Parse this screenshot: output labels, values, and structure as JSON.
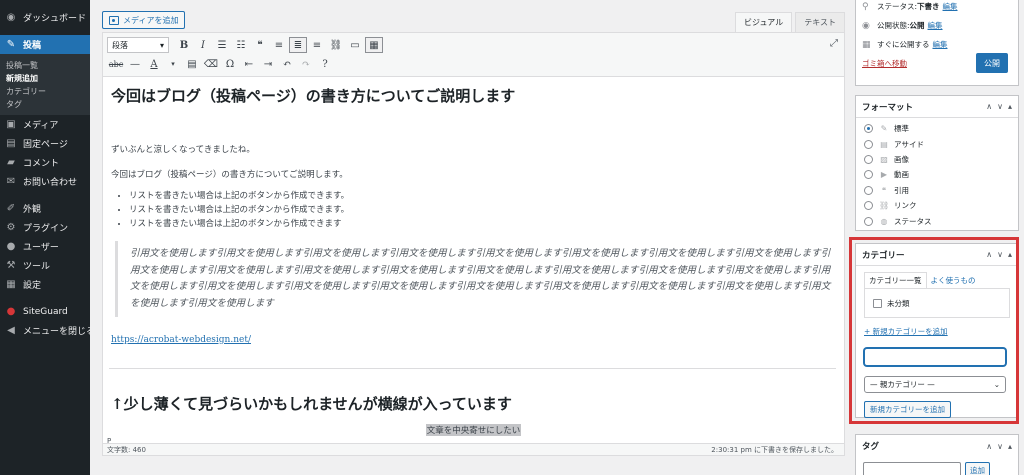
{
  "menu": {
    "dashboard": "ダッシュボード",
    "posts": "投稿",
    "posts_sub": [
      "投稿一覧",
      "新規追加",
      "カテゴリー",
      "タグ"
    ],
    "media": "メディア",
    "pages": "固定ページ",
    "comments": "コメント",
    "contact": "お問い合わせ",
    "appearance": "外観",
    "plugins": "プラグイン",
    "users": "ユーザー",
    "tools": "ツール",
    "settings": "設定",
    "siteguard": "SiteGuard",
    "collapse": "メニューを閉じる"
  },
  "editor": {
    "media_button": "メディアを追加",
    "tab_visual": "ビジュアル",
    "tab_text": "テキスト",
    "format_select": "段落",
    "title": "今回はブログ（投稿ページ）の書き方についてご説明します",
    "para1": "ずいぶんと涼しくなってきましたね。",
    "para2": "今回はブログ（投稿ページ）の書き方についてご説明します。",
    "list": [
      "リストを書きたい場合は上記のボタンから作成できます。",
      "リストを書きたい場合は上記のボタンから作成できます。",
      "リストを書きたい場合は上記のボタンから作成できます"
    ],
    "quote": "引用文を使用します引用文を使用します引用文を使用します引用文を使用します引用文を使用します引用文を使用します引用文を使用します引用文を使用します引用文を使用します引用文を使用します引用文を使用します引用文を使用します引用文を使用します引用文を使用します引用文を使用します引用文を使用します引用文を使用します引用文を使用します引用文を使用します引用文を使用します引用文を使用します引用文を使用します引用文を使用します引用文を使用します引用文を使用します引用文を使用します",
    "link": "https://acrobat-webdesign.net/",
    "heading2": "↑少し薄くて見づらいかもしれませんが横線が入っています",
    "center_text": "文章を中央寄せにしたい",
    "path": "P",
    "word_count": "文字数: 460",
    "saved": "2:30:31 pm に下書きを保存しました。"
  },
  "publish": {
    "status_label": "ステータス: ",
    "status_value": "下書き",
    "visibility_label": "公開状態: ",
    "visibility_value": "公開",
    "schedule": "すぐに公開する",
    "edit": "編集",
    "trash": "ゴミ箱へ移動",
    "publish_button": "公開"
  },
  "format": {
    "title": "フォーマット",
    "options": [
      "標準",
      "アサイド",
      "画像",
      "動画",
      "引用",
      "リンク",
      "ステータス"
    ]
  },
  "category": {
    "title": "カテゴリー",
    "tab_all": "カテゴリー一覧",
    "tab_popular": "よく使うもの",
    "items": [
      "未分類"
    ],
    "add_link": "+ 新規カテゴリーを追加",
    "input_value": "",
    "parent_select": "— 親カテゴリー —",
    "add_button": "新規カテゴリーを追加"
  },
  "tags": {
    "title": "タグ",
    "add_button": "追加"
  }
}
